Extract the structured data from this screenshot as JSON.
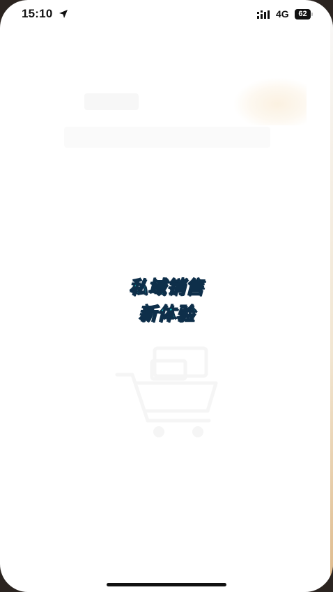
{
  "status_bar": {
    "time": "15:10",
    "network": "4G",
    "battery_level": "62",
    "icons": [
      "location-arrow-icon",
      "signal-icon",
      "battery-icon"
    ]
  },
  "splash": {
    "slogan_line1": "私域销售",
    "slogan_line2": "新体验"
  },
  "colors": {
    "background": "#ffffff",
    "slogan_fill": "#16c6c6",
    "slogan_outline": "#0e2f4a"
  }
}
